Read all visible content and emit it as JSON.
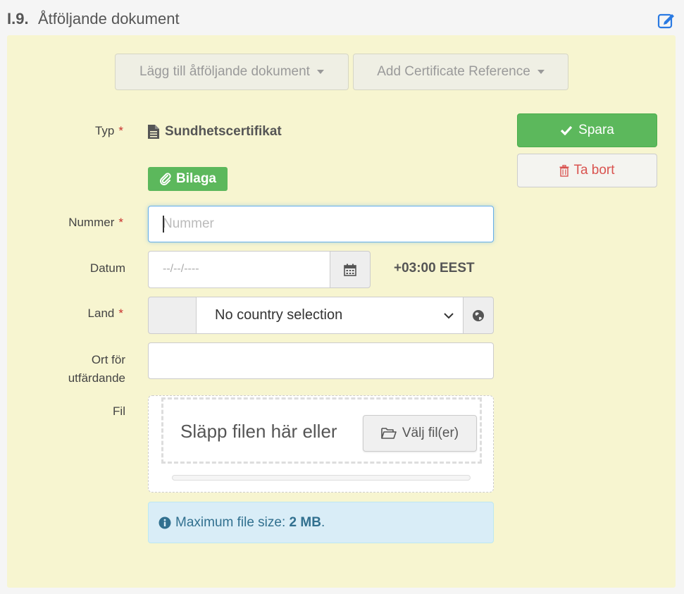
{
  "section": {
    "code": "I.9.",
    "title": "Åtföljande dokument",
    "edit_icon": "edit-icon"
  },
  "toolbar": {
    "add_document_label": "Lägg till åtföljande dokument",
    "add_certificate_label": "Add Certificate Reference"
  },
  "form": {
    "typ": {
      "label": "Typ",
      "required": "*",
      "value": "Sundhetscertifikat"
    },
    "badge_label": "Bilaga",
    "nummer": {
      "label": "Nummer",
      "required": "*",
      "placeholder": "Nummer"
    },
    "datum": {
      "label": "Datum",
      "placeholder": "--/--/----",
      "timezone": "+03:00 EEST"
    },
    "land": {
      "label": "Land",
      "required": "*",
      "selected": "No country selection"
    },
    "ort": {
      "label_line1": "Ort för",
      "label_line2": "utfärdande"
    },
    "fil": {
      "label": "Fil",
      "drop_text": "Släpp filen här eller",
      "choose_label": "Välj fil(er)"
    },
    "info": {
      "prefix": "Maximum file size: ",
      "size": "2 MB",
      "suffix": "."
    }
  },
  "actions": {
    "save_label": "Spara",
    "delete_label": "Ta bort"
  },
  "colors": {
    "panel_bg": "#f7f5d0",
    "success": "#5cb85c",
    "danger": "#d9534f",
    "info_bg": "#d9edf7",
    "info_text": "#31708f",
    "link_blue": "#2a7ae2"
  }
}
